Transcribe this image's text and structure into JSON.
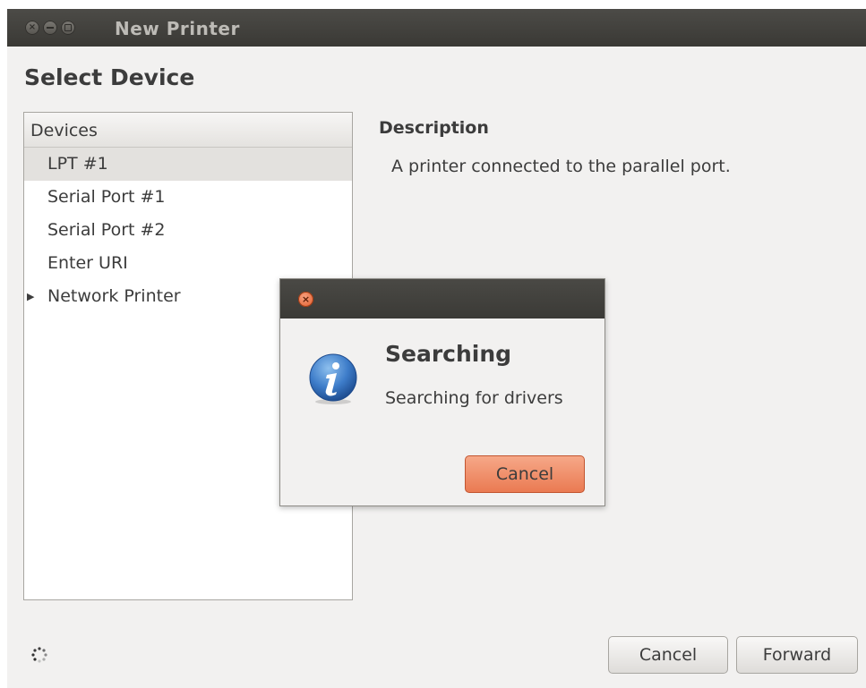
{
  "window": {
    "title": "New Printer"
  },
  "page": {
    "heading": "Select Device"
  },
  "devices": {
    "column_header": "Devices",
    "items": [
      {
        "label": "LPT #1",
        "selected": true
      },
      {
        "label": "Serial Port #1"
      },
      {
        "label": "Serial Port #2"
      },
      {
        "label": "Enter URI"
      },
      {
        "label": "Network Printer",
        "expandable": true
      }
    ]
  },
  "description": {
    "title": "Description",
    "text": "A printer connected to the parallel port."
  },
  "dialog": {
    "title": "Searching",
    "message": "Searching for drivers",
    "cancel_label": "Cancel",
    "icon": "info-icon",
    "close_glyph": "×"
  },
  "footer": {
    "cancel_label": "Cancel",
    "forward_label": "Forward",
    "spinner_icon": "spinner-icon"
  },
  "colors": {
    "titlebar": "#3c3b37",
    "accent": "#ea7a52",
    "window_bg": "#f2f1f0"
  }
}
